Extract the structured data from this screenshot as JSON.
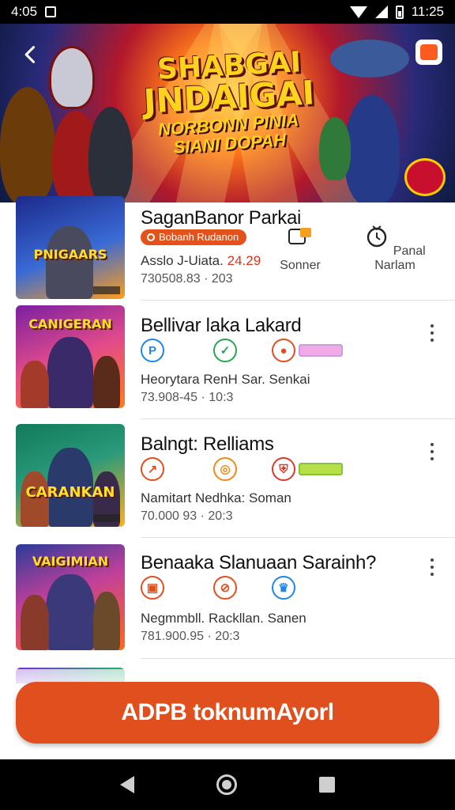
{
  "status_bar": {
    "time_left": "4:05",
    "time_right": "11:25"
  },
  "banner": {
    "title_line1": "SHABGAI",
    "title_line2": "JNDAIGAI",
    "subtitle_line1": "NORBONN PINIA",
    "subtitle_line2": "SIANI DOPAH"
  },
  "items": [
    {
      "title": "SaganBanor Parkai",
      "tag": "Bobanh Rudanon",
      "meta": "Asslo J-Uiata.",
      "meta_highlight": "24.29",
      "sub": "730508.83 · 203",
      "stats": [
        {
          "label": "Sonner",
          "icon": "badge-icon"
        },
        {
          "label": "Panal Narlam",
          "icon": "alarm-icon"
        }
      ],
      "thumb_caption": "PNIGAARS",
      "thumb_colors": [
        "#1b2a8a",
        "#ff9d1a"
      ]
    },
    {
      "title": "Bellivar laka Lakard",
      "meta": "Heorytara RenH Sar. Senkai",
      "sub": "73.908-45 · 10:3",
      "icons": [
        {
          "name": "p-icon",
          "glyph": "P",
          "color": "#1e88e5"
        },
        {
          "name": "chat-icon",
          "glyph": "✓",
          "color": "#2aa44f"
        },
        {
          "name": "avatar-icon",
          "glyph": "●",
          "color": "#e0501e"
        }
      ],
      "thumb_caption": "CANIGERAN",
      "thumb_colors": [
        "#7a1fa2",
        "#ff7b1a"
      ]
    },
    {
      "title": "Balngt: Relliams",
      "meta": "Namitart Nedhka: Soman",
      "sub": "70.000 93 · 20:3",
      "icons": [
        {
          "name": "arrow-icon",
          "glyph": "↗",
          "color": "#e0501e"
        },
        {
          "name": "target-icon",
          "glyph": "◎",
          "color": "#f08a1a"
        },
        {
          "name": "shield-icon",
          "glyph": "⛨",
          "color": "#d93b2b"
        }
      ],
      "thumb_caption": "CARANKAN",
      "thumb_colors": [
        "#127a5a",
        "#ffb020"
      ]
    },
    {
      "title": "Benaaka Slanuaan Sarainh?",
      "meta": "Negmmbll. Rackllan. Sanen",
      "sub": "781.900.95 · 20:3",
      "icons": [
        {
          "name": "square-icon",
          "glyph": "▣",
          "color": "#e0501e"
        },
        {
          "name": "compass-icon",
          "glyph": "⊘",
          "color": "#e0501e"
        },
        {
          "name": "trophy-icon",
          "glyph": "♛",
          "color": "#1e88e5"
        }
      ],
      "thumb_caption": "VAIGIMIAN",
      "thumb_colors": [
        "#2b3b9a",
        "#ff6a1a"
      ]
    }
  ],
  "cta": {
    "label": "ADPB toknumAyorl"
  },
  "colors": {
    "accent": "#e0501e",
    "divider": "#e1e1e1"
  }
}
